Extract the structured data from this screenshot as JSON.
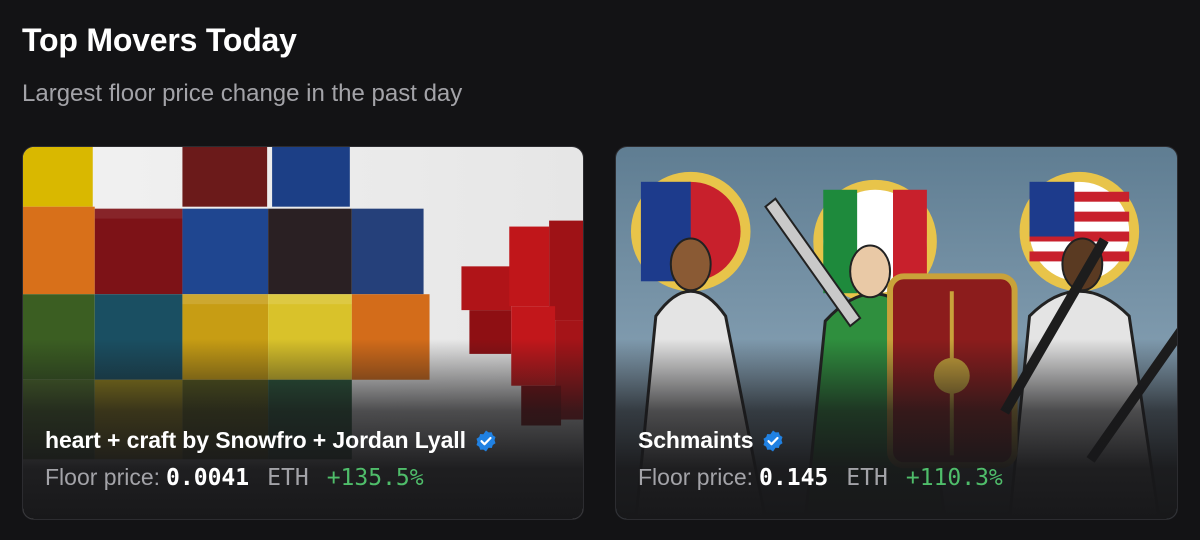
{
  "header": {
    "title": "Top Movers Today",
    "subtitle": "Largest floor price change in the past day"
  },
  "cards": [
    {
      "name": "heart + craft by Snowfro + Jordan Lyall",
      "verified": true,
      "floor_label": "Floor price:",
      "floor_value": "0.0041",
      "currency": "ETH",
      "change": "+135.5%",
      "artwork": "colorful-voxel-cubes-image"
    },
    {
      "name": "Schmaints",
      "verified": true,
      "floor_label": "Floor price:",
      "floor_value": "0.145",
      "currency": "ETH",
      "change": "+110.3%",
      "artwork": "three-saints-illustration-image"
    }
  ],
  "colors": {
    "background": "#131315",
    "positive_change": "#4fbd6a",
    "verified_badge": "#2081e2",
    "muted_text": "#a3a3a8"
  }
}
